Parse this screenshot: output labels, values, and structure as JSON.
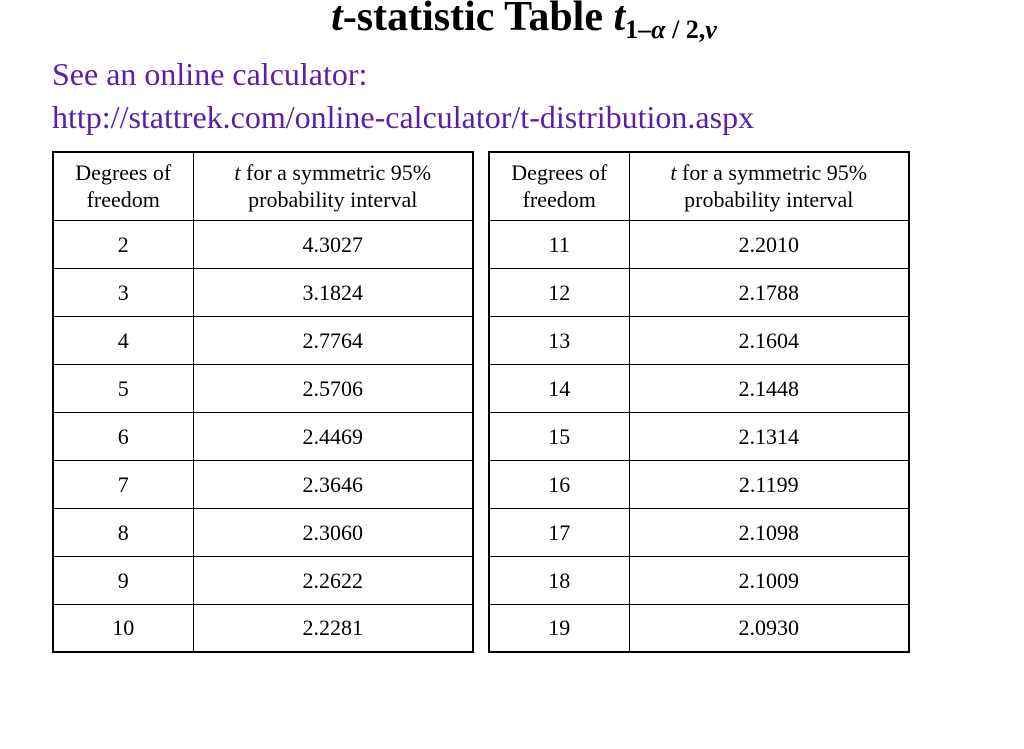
{
  "title": {
    "prefix_italic": "t",
    "main": "-statistic Table  ",
    "sub_prefix_italic": "t",
    "sub_open": "1–",
    "sub_alpha": "α",
    "sub_mid": " / 2,",
    "sub_nu": "ν"
  },
  "intro": {
    "line1": "See an online calculator:",
    "line2": "http://stattrek.com/online-calculator/t-distribution.aspx"
  },
  "headers": {
    "df_line1": "Degrees of",
    "df_line2": "freedom",
    "tv_prefix_italic": "t",
    "tv_rest_line1": " for a symmetric 95%",
    "tv_line2": "probability interval"
  },
  "chart_data": {
    "type": "table",
    "title": "t-statistic Table (two-sided 95%)",
    "columns": [
      "Degrees of freedom",
      "t for a symmetric 95% probability interval"
    ],
    "left": [
      {
        "df": "2",
        "t": "4.3027"
      },
      {
        "df": "3",
        "t": "3.1824"
      },
      {
        "df": "4",
        "t": "2.7764"
      },
      {
        "df": "5",
        "t": "2.5706"
      },
      {
        "df": "6",
        "t": "2.4469"
      },
      {
        "df": "7",
        "t": "2.3646"
      },
      {
        "df": "8",
        "t": "2.3060"
      },
      {
        "df": "9",
        "t": "2.2622"
      },
      {
        "df": "10",
        "t": "2.2281"
      }
    ],
    "right": [
      {
        "df": "11",
        "t": "2.2010"
      },
      {
        "df": "12",
        "t": "2.1788"
      },
      {
        "df": "13",
        "t": "2.1604"
      },
      {
        "df": "14",
        "t": "2.1448"
      },
      {
        "df": "15",
        "t": "2.1314"
      },
      {
        "df": "16",
        "t": "2.1199"
      },
      {
        "df": "17",
        "t": "2.1098"
      },
      {
        "df": "18",
        "t": "2.1009"
      },
      {
        "df": "19",
        "t": "2.0930"
      }
    ]
  }
}
